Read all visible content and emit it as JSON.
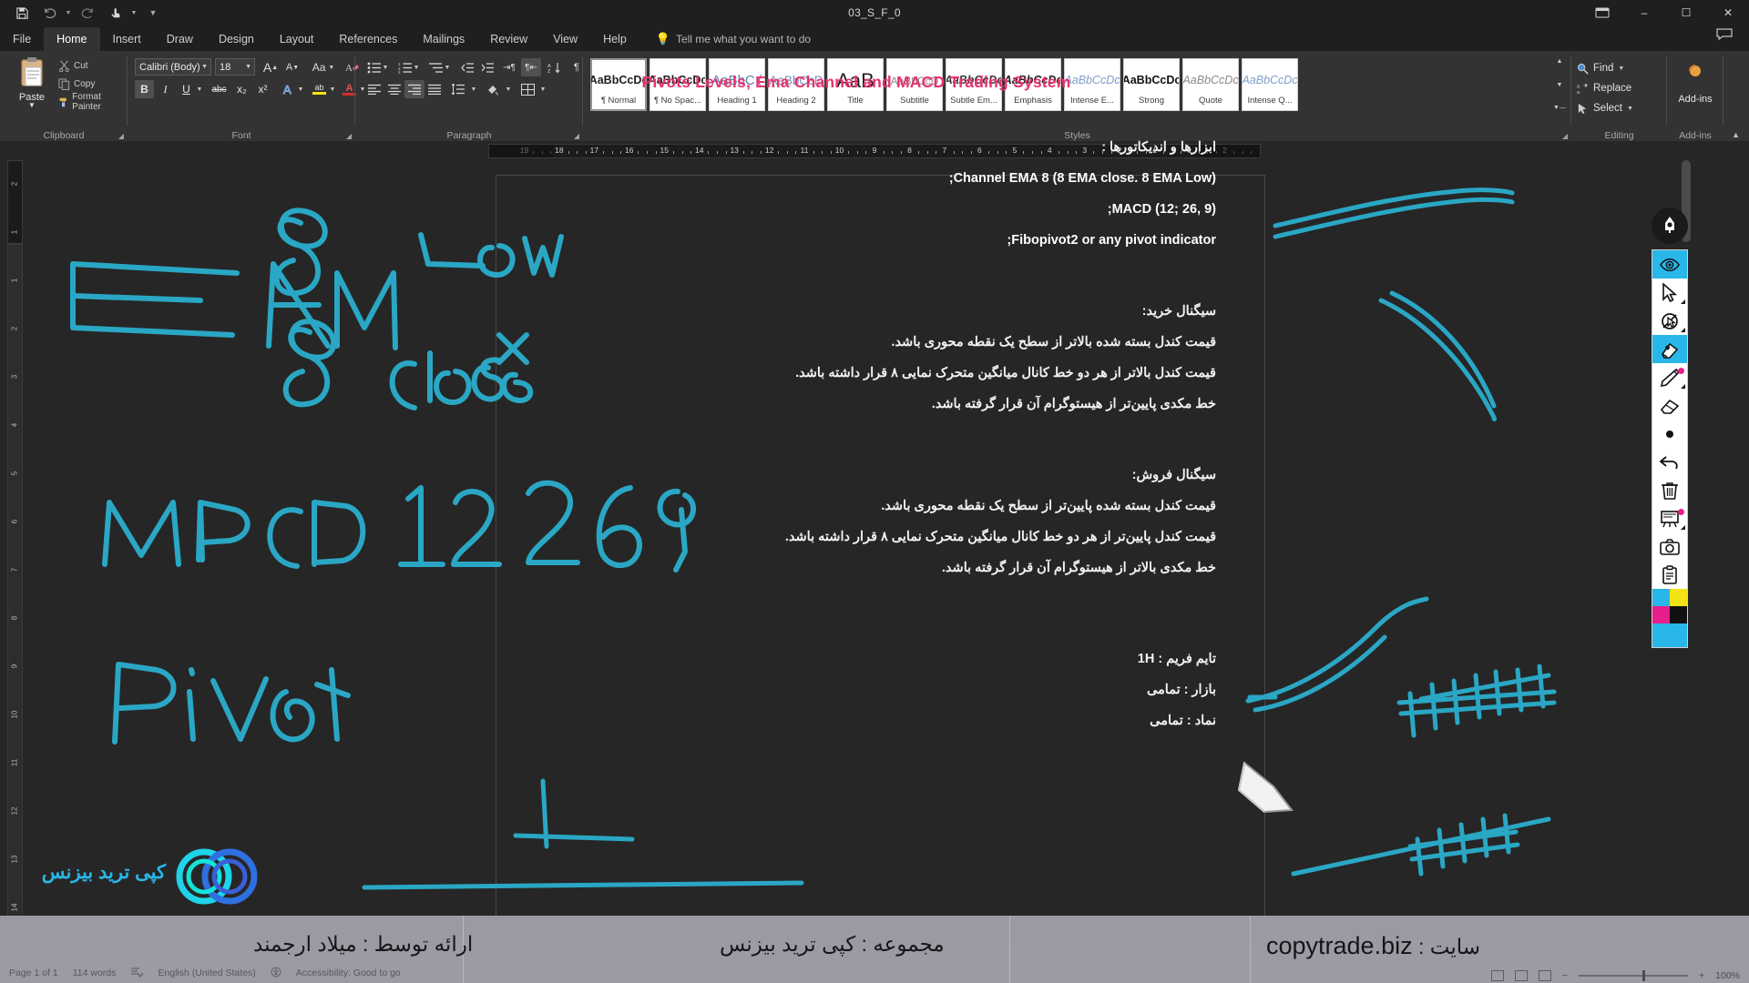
{
  "window": {
    "title": "03_S_F_0",
    "qat": [
      {
        "name": "save-icon",
        "label": "Save"
      },
      {
        "name": "undo-icon",
        "label": "Undo"
      },
      {
        "name": "redo-icon",
        "label": "Redo"
      },
      {
        "name": "touch-mode-icon",
        "label": "Touch/Mouse Mode"
      },
      {
        "name": "customize-qat-icon",
        "label": "Customize Quick Access Toolbar"
      }
    ],
    "controls": {
      "minimize": "–",
      "maximize": "☐",
      "close": "✕",
      "restore_ribbon": "∧"
    }
  },
  "tabs": [
    {
      "label": "File",
      "active": false
    },
    {
      "label": "Home",
      "active": true
    },
    {
      "label": "Insert",
      "active": false
    },
    {
      "label": "Draw",
      "active": false
    },
    {
      "label": "Design",
      "active": false
    },
    {
      "label": "Layout",
      "active": false
    },
    {
      "label": "References",
      "active": false
    },
    {
      "label": "Mailings",
      "active": false
    },
    {
      "label": "Review",
      "active": false
    },
    {
      "label": "View",
      "active": false
    },
    {
      "label": "Help",
      "active": false
    }
  ],
  "tellme": {
    "placeholder": "Tell me what you want to do",
    "icon": "lightbulb-icon"
  },
  "comments": {
    "label": "Comments",
    "icon": "comment-icon"
  },
  "ribbon": {
    "groups": [
      {
        "name": "Clipboard",
        "label": "Clipboard"
      },
      {
        "name": "Font",
        "label": "Font"
      },
      {
        "name": "Paragraph",
        "label": "Paragraph"
      },
      {
        "name": "Styles",
        "label": "Styles"
      },
      {
        "name": "Editing",
        "label": "Editing"
      },
      {
        "name": "Add-ins",
        "label": "Add-ins"
      }
    ],
    "clipboard": {
      "paste_label": "Paste",
      "cut_label": "Cut",
      "copy_label": "Copy",
      "format_painter_label": "Format Painter"
    },
    "font": {
      "font_name": "Calibri (Body)",
      "font_size": "18",
      "grow_font": "A",
      "shrink_font": "A",
      "change_case": "Aa",
      "clear_formatting": "Clear All Formatting",
      "bold": "B",
      "italic": "I",
      "underline": "U",
      "strikethrough": "abc",
      "subscript": "x₂",
      "superscript": "x²",
      "text_effects": "A",
      "highlight": "ab",
      "font_color": "A"
    },
    "paragraph": {
      "bullets": "Bullets",
      "numbering": "Numbering",
      "multilevel": "Multilevel List",
      "decrease_indent": "Decrease Indent",
      "increase_indent": "Increase Indent",
      "sort": "Sort",
      "show_marks": "¶",
      "align_left": "Align Left",
      "align_center": "Center",
      "align_right": "Align Right",
      "justify": "Justify",
      "line_spacing": "Line and Paragraph Spacing",
      "shading": "Shading",
      "borders": "Borders",
      "ltr_direction": "Left-to-Right Text Direction",
      "rtl_direction": "Right-to-Left Text Direction"
    },
    "styles": [
      {
        "sample": "AaBbCcDc",
        "name": "¶ Normal",
        "selected": true,
        "style": "normal"
      },
      {
        "sample": "AaBbCcDc",
        "name": "¶ No Spac...",
        "selected": false,
        "style": "normal"
      },
      {
        "sample": "AaBbC (",
        "name": "Heading 1",
        "selected": false,
        "style": "h1"
      },
      {
        "sample": "AaBbCcD",
        "name": "Heading 2",
        "selected": false,
        "style": "h2"
      },
      {
        "sample": "AaB",
        "name": "Title",
        "selected": false,
        "style": "title"
      },
      {
        "sample": "AaBbCcD",
        "name": "Subtitle",
        "selected": false,
        "style": "subtitle"
      },
      {
        "sample": "AaBbCcDc",
        "name": "Subtle Em...",
        "selected": false,
        "style": "subtle-em"
      },
      {
        "sample": "AaBbCcDc",
        "name": "Emphasis",
        "selected": false,
        "style": "emphasis"
      },
      {
        "sample": "AaBbCcDc",
        "name": "Intense E...",
        "selected": false,
        "style": "intense-em"
      },
      {
        "sample": "AaBbCcDc",
        "name": "Strong",
        "selected": false,
        "style": "strong"
      },
      {
        "sample": "AaBbCcDc",
        "name": "Quote",
        "selected": false,
        "style": "quote"
      },
      {
        "sample": "AaBbCcDc",
        "name": "Intense Q...",
        "selected": false,
        "style": "intense-q"
      }
    ],
    "editing": {
      "find": "Find",
      "replace": "Replace",
      "select": "Select"
    },
    "addins": {
      "button_label": "Add-ins"
    }
  },
  "ruler": {
    "corner_label": "L",
    "horizontal_ticks": [
      "19",
      "18",
      "17",
      "16",
      "15",
      "14",
      "13",
      "12",
      "11",
      "10",
      "9",
      "8",
      "7",
      "6",
      "5",
      "4",
      "3",
      "2",
      "1",
      "1",
      "2"
    ],
    "vertical_ticks": [
      "2",
      "1",
      "1",
      "2",
      "3",
      "4",
      "5",
      "6",
      "7",
      "8",
      "9",
      "10",
      "11",
      "12",
      "13",
      "14"
    ]
  },
  "document": {
    "title": "Pivots Levels, Ema Channel and MACD Trading System",
    "title_color": "#e8336d",
    "lines": [
      "ابزارها و اندیکاتورها :",
      "Channel EMA 8 (8 EMA close. 8 EMA Low);",
      "MACD (12; 26, 9);",
      "Fibopivot2 or any pivot indicator;"
    ],
    "buy_heading": "سیگنال خرید:",
    "buy_rules": [
      "قیمت کندل بسته شده بالاتر از سطح یک نقطه محوری باشد.",
      "قیمت کندل بالاتر از هر دو خط کانال میانگین متحرک نمایی ۸ قرار داشته باشد.",
      "خط مکدی پایین‌تر از هیستوگرام آن قرار گرفته باشد."
    ],
    "sell_heading": "سیگنال فروش:",
    "sell_rules": [
      "قیمت کندل بسته شده پایین‌تر از سطح یک نقطه محوری باشد.",
      "قیمت کندل پایین‌تر از هر دو خط کانال میانگین متحرک نمایی ۸ قرار داشته باشد.",
      "خط مکدی بالاتر از هیستوگرام آن قرار گرفته باشد."
    ],
    "meta": [
      "تایم فریم : 1H",
      "بازار : تمامی",
      "نماد : تمامی"
    ]
  },
  "ink_annotations": {
    "color": "#2aa7c4",
    "labels": [
      "EMA",
      "8",
      "8",
      "Low",
      "Close",
      "MACD",
      "12",
      "26",
      "9",
      "PIVOT"
    ]
  },
  "pen_toolbar": {
    "logo": "pen-logo-icon",
    "tools": [
      {
        "name": "eye-icon",
        "label": "Show/Hide Annotations",
        "selected": true
      },
      {
        "name": "cursor-arrow-icon",
        "label": "Select",
        "selected": false,
        "submenu": true
      },
      {
        "name": "no-pointer-icon",
        "label": "Pointer Off",
        "selected": false,
        "submenu": true
      },
      {
        "name": "highlighter-icon",
        "label": "Highlighter",
        "selected": true
      },
      {
        "name": "pen-icon",
        "label": "Pen",
        "selected": false,
        "submenu": true,
        "dot": "#e91e8c"
      },
      {
        "name": "eraser-icon",
        "label": "Eraser",
        "selected": false
      },
      {
        "name": "dot-icon",
        "label": "Laser Dot",
        "selected": false
      },
      {
        "name": "undo-arrow-icon",
        "label": "Undo",
        "selected": false
      },
      {
        "name": "trash-icon",
        "label": "Clear All",
        "selected": false
      },
      {
        "name": "whiteboard-icon",
        "label": "Whiteboard",
        "selected": false,
        "submenu": true,
        "dot": "#e91e8c"
      },
      {
        "name": "camera-icon",
        "label": "Screenshot",
        "selected": false
      },
      {
        "name": "clipboard-icon",
        "label": "Notes",
        "selected": false
      }
    ],
    "swatches": [
      "#29b6e8",
      "#f2e317",
      "#e91e8c",
      "#111111"
    ],
    "active_color": "#29b6e8"
  },
  "statusbar": {
    "page": "Page 1 of 1",
    "words": "114 words",
    "proofing_icon": "proofing-icon",
    "language": "English (United States)",
    "accessibility": "Accessibility: Good to go",
    "views": [
      "read-mode-icon",
      "print-layout-icon",
      "web-layout-icon"
    ],
    "zoom_out": "−",
    "zoom_in": "+",
    "zoom": "100%"
  },
  "brandbar": {
    "site_label": "سایت :",
    "site_value": "copytrade.biz",
    "collection": "مجموعه : کپی ترید بیزنس",
    "presenter": "ارائه توسط : میلاد ارجمند"
  },
  "watermark": {
    "text": "کپی ترید بیزنس",
    "color": "#29b6e8"
  }
}
